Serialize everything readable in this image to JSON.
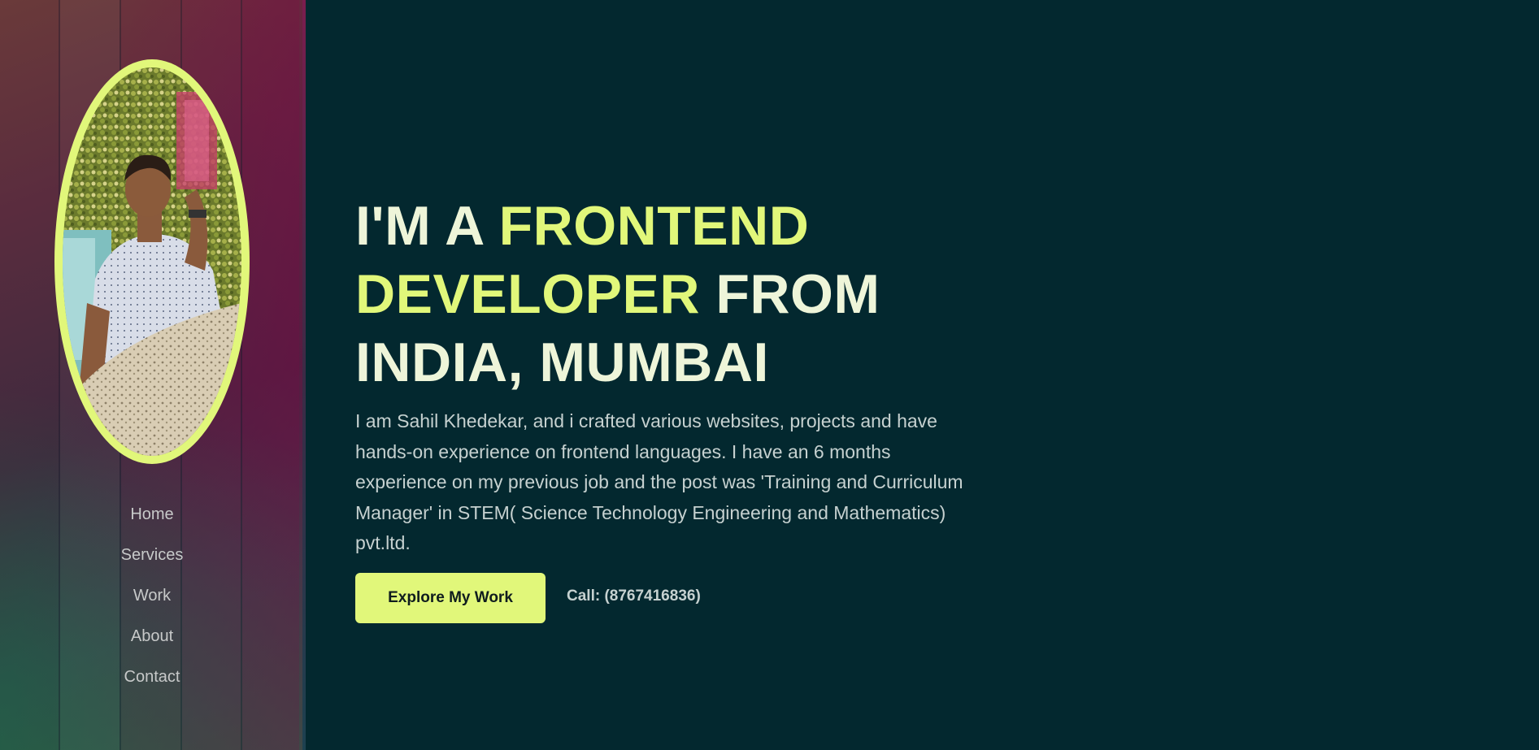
{
  "colors": {
    "background": "#03282f",
    "accent": "#e1f77a",
    "headline_text": "#eef5d9",
    "body_text": "#c6d1d0",
    "nav_text": "#c7c9c9"
  },
  "sidebar": {
    "avatar": "profile-photo",
    "nav": [
      {
        "label": "Home"
      },
      {
        "label": "Services"
      },
      {
        "label": "Work"
      },
      {
        "label": "About"
      },
      {
        "label": "Contact"
      }
    ]
  },
  "hero": {
    "headline_part1": "I'M A ",
    "headline_accent1": "FRONTEND",
    "headline_accent2": "DEVELOPER",
    "headline_part2": " FROM",
    "headline_part3": "INDIA, MUMBAI",
    "intro": "I am Sahil Khedekar, and i crafted various websites, projects and have hands-on experience on frontend languages. I have an 6 months experience on my previous job and the post was 'Training and Curriculum Manager' in STEM( Science Technology Engineering and Mathematics) pvt.ltd.",
    "explore_button": "Explore My Work",
    "call_text": "Call: (8767416836)"
  }
}
